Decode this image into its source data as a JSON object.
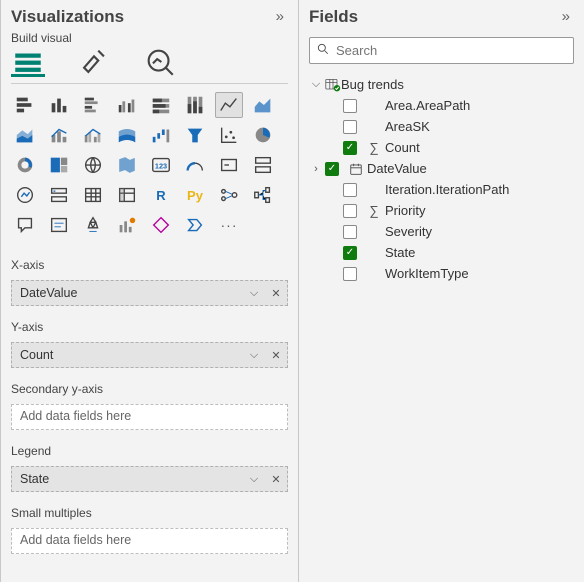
{
  "viz": {
    "pane_title": "Visualizations",
    "build_label": "Build visual",
    "wells": {
      "x_axis": {
        "label": "X-axis",
        "value": "DateValue"
      },
      "y_axis": {
        "label": "Y-axis",
        "value": "Count"
      },
      "secondary_y": {
        "label": "Secondary y-axis",
        "placeholder": "Add data fields here"
      },
      "legend": {
        "label": "Legend",
        "value": "State"
      },
      "small_multiples": {
        "label": "Small multiples",
        "placeholder": "Add data fields here"
      }
    }
  },
  "fields": {
    "pane_title": "Fields",
    "search_placeholder": "Search",
    "table_name": "Bug trends",
    "items": [
      {
        "name": "Area.AreaPath",
        "checked": false,
        "icon": ""
      },
      {
        "name": "AreaSK",
        "checked": false,
        "icon": ""
      },
      {
        "name": "Count",
        "checked": true,
        "icon": "sigma"
      },
      {
        "name": "DateValue",
        "checked": true,
        "icon": "calendar",
        "expandable": true
      },
      {
        "name": "Iteration.IterationPath",
        "checked": false,
        "icon": ""
      },
      {
        "name": "Priority",
        "checked": false,
        "icon": "sigma"
      },
      {
        "name": "Severity",
        "checked": false,
        "icon": ""
      },
      {
        "name": "State",
        "checked": true,
        "icon": ""
      },
      {
        "name": "WorkItemType",
        "checked": false,
        "icon": ""
      }
    ]
  }
}
